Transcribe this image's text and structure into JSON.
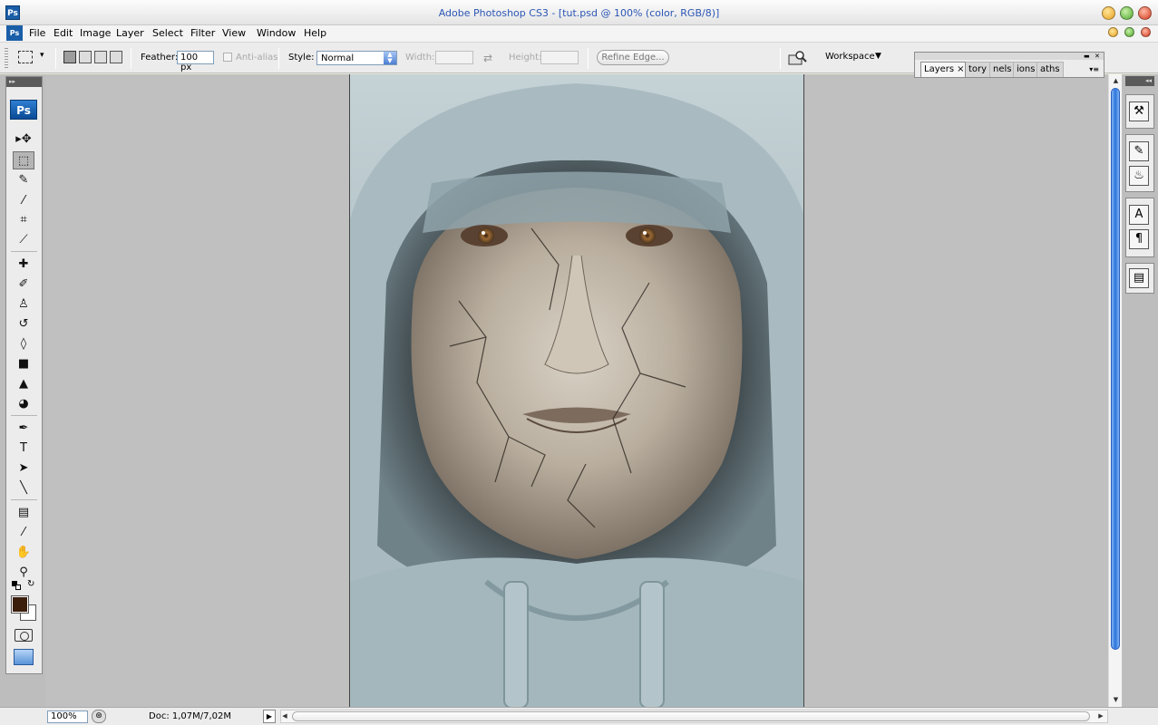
{
  "window": {
    "title": "Adobe Photoshop CS3 - [tut.psd @ 100% (color, RGB/8)]",
    "app_icon": "Ps",
    "doc_icon": "Ps"
  },
  "menu": [
    "File",
    "Edit",
    "Image",
    "Layer",
    "Select",
    "Filter",
    "View",
    "Window",
    "Help"
  ],
  "options": {
    "feather_label": "Feather:",
    "feather_value": "100 px",
    "antialias_label": "Anti-alias",
    "style_label": "Style:",
    "style_value": "Normal",
    "width_label": "Width:",
    "height_label": "Height:",
    "refine_edge": "Refine Edge...",
    "workspace": "Workspace"
  },
  "panels": {
    "tabs": [
      "Layers",
      "tory",
      "nels",
      "ions",
      "aths"
    ],
    "close_glyph": "×"
  },
  "toolbox": {
    "logo": "Ps",
    "tools": [
      {
        "name": "move-tool",
        "glyph": "▸✥"
      },
      {
        "name": "rectangular-marquee-tool",
        "glyph": "⬚"
      },
      {
        "name": "lasso-tool",
        "glyph": "✎"
      },
      {
        "name": "magic-wand-tool",
        "glyph": "⁄"
      },
      {
        "name": "crop-tool",
        "glyph": "⌗"
      },
      {
        "name": "slice-tool",
        "glyph": "⟋"
      },
      {
        "name": "healing-brush-tool",
        "glyph": "✚"
      },
      {
        "name": "brush-tool",
        "glyph": "✐"
      },
      {
        "name": "clone-stamp-tool",
        "glyph": "♙"
      },
      {
        "name": "history-brush-tool",
        "glyph": "↺"
      },
      {
        "name": "eraser-tool",
        "glyph": "◊"
      },
      {
        "name": "gradient-tool",
        "glyph": "■"
      },
      {
        "name": "blur-tool",
        "glyph": "▲"
      },
      {
        "name": "dodge-tool",
        "glyph": "◕"
      },
      {
        "name": "pen-tool",
        "glyph": "✒"
      },
      {
        "name": "type-tool",
        "glyph": "T"
      },
      {
        "name": "path-selection-tool",
        "glyph": "➤"
      },
      {
        "name": "line-tool",
        "glyph": "╲"
      },
      {
        "name": "notes-tool",
        "glyph": "▤"
      },
      {
        "name": "eyedropper-tool",
        "glyph": "⁄"
      },
      {
        "name": "hand-tool",
        "glyph": "✋"
      },
      {
        "name": "zoom-tool",
        "glyph": "⚲"
      }
    ],
    "foreground_color": "#3b1e0c",
    "background_color": "#ffffff"
  },
  "right_dock": [
    {
      "name": "tool-presets-icon",
      "glyph": "⚒"
    },
    {
      "name": "brushes-icon",
      "glyph": "✎"
    },
    {
      "name": "clone-source-icon",
      "glyph": "♨"
    },
    {
      "name": "character-icon",
      "glyph": "A"
    },
    {
      "name": "paragraph-icon",
      "glyph": "¶"
    },
    {
      "name": "layer-comps-icon",
      "glyph": "▤"
    }
  ],
  "status": {
    "zoom": "100%",
    "doc": "Doc: 1,07M/7,02M"
  }
}
